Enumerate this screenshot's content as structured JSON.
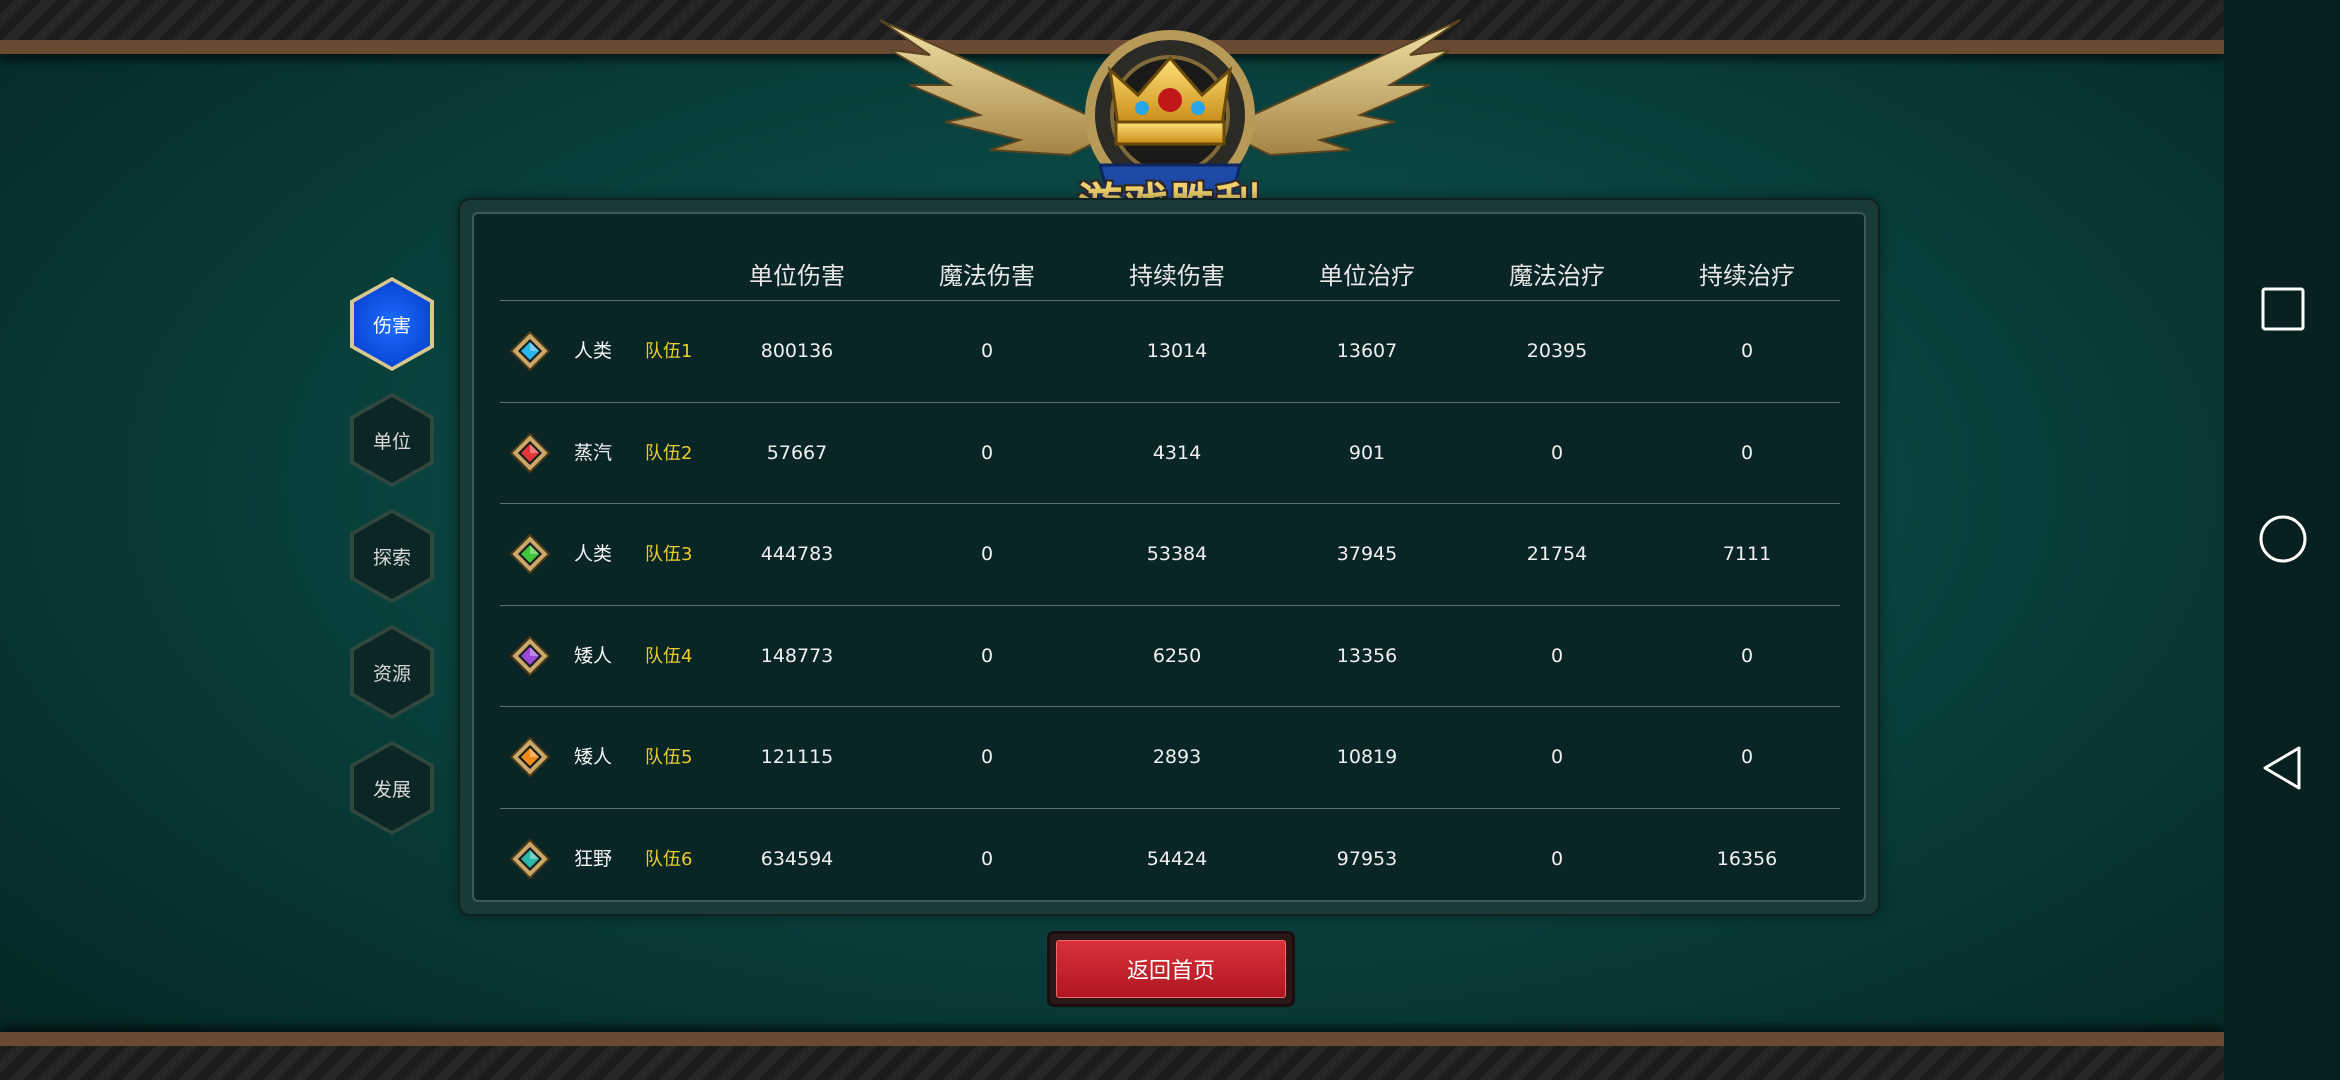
{
  "emblem": {
    "title": "游戏胜利"
  },
  "menu": [
    {
      "label": "伤害",
      "active": true
    },
    {
      "label": "单位",
      "active": false
    },
    {
      "label": "探索",
      "active": false
    },
    {
      "label": "资源",
      "active": false
    },
    {
      "label": "发展",
      "active": false
    }
  ],
  "table": {
    "headers": [
      "单位伤害",
      "魔法伤害",
      "持续伤害",
      "单位治疗",
      "魔法治疗",
      "持续治疗"
    ],
    "rows": [
      {
        "gem": "#2ab6e8",
        "race": "人类",
        "team": "队伍1",
        "values": [
          "800136",
          "0",
          "13014",
          "13607",
          "20395",
          "0"
        ]
      },
      {
        "gem": "#e03838",
        "race": "蒸汽",
        "team": "队伍2",
        "values": [
          "57667",
          "0",
          "4314",
          "901",
          "0",
          "0"
        ]
      },
      {
        "gem": "#3cc43a",
        "race": "人类",
        "team": "队伍3",
        "values": [
          "444783",
          "0",
          "53384",
          "37945",
          "21754",
          "7111"
        ]
      },
      {
        "gem": "#9a48d8",
        "race": "矮人",
        "team": "队伍4",
        "values": [
          "148773",
          "0",
          "6250",
          "13356",
          "0",
          "0"
        ]
      },
      {
        "gem": "#f08a18",
        "race": "矮人",
        "team": "队伍5",
        "values": [
          "121115",
          "0",
          "2893",
          "10819",
          "0",
          "0"
        ]
      },
      {
        "gem": "#2cb8a8",
        "race": "狂野",
        "team": "队伍6",
        "values": [
          "634594",
          "0",
          "54424",
          "97953",
          "0",
          "16356"
        ]
      }
    ]
  },
  "back_button": {
    "label": "返回首页"
  },
  "nav": {
    "icons": [
      "square-icon",
      "circle-icon",
      "triangle-back-icon"
    ]
  }
}
